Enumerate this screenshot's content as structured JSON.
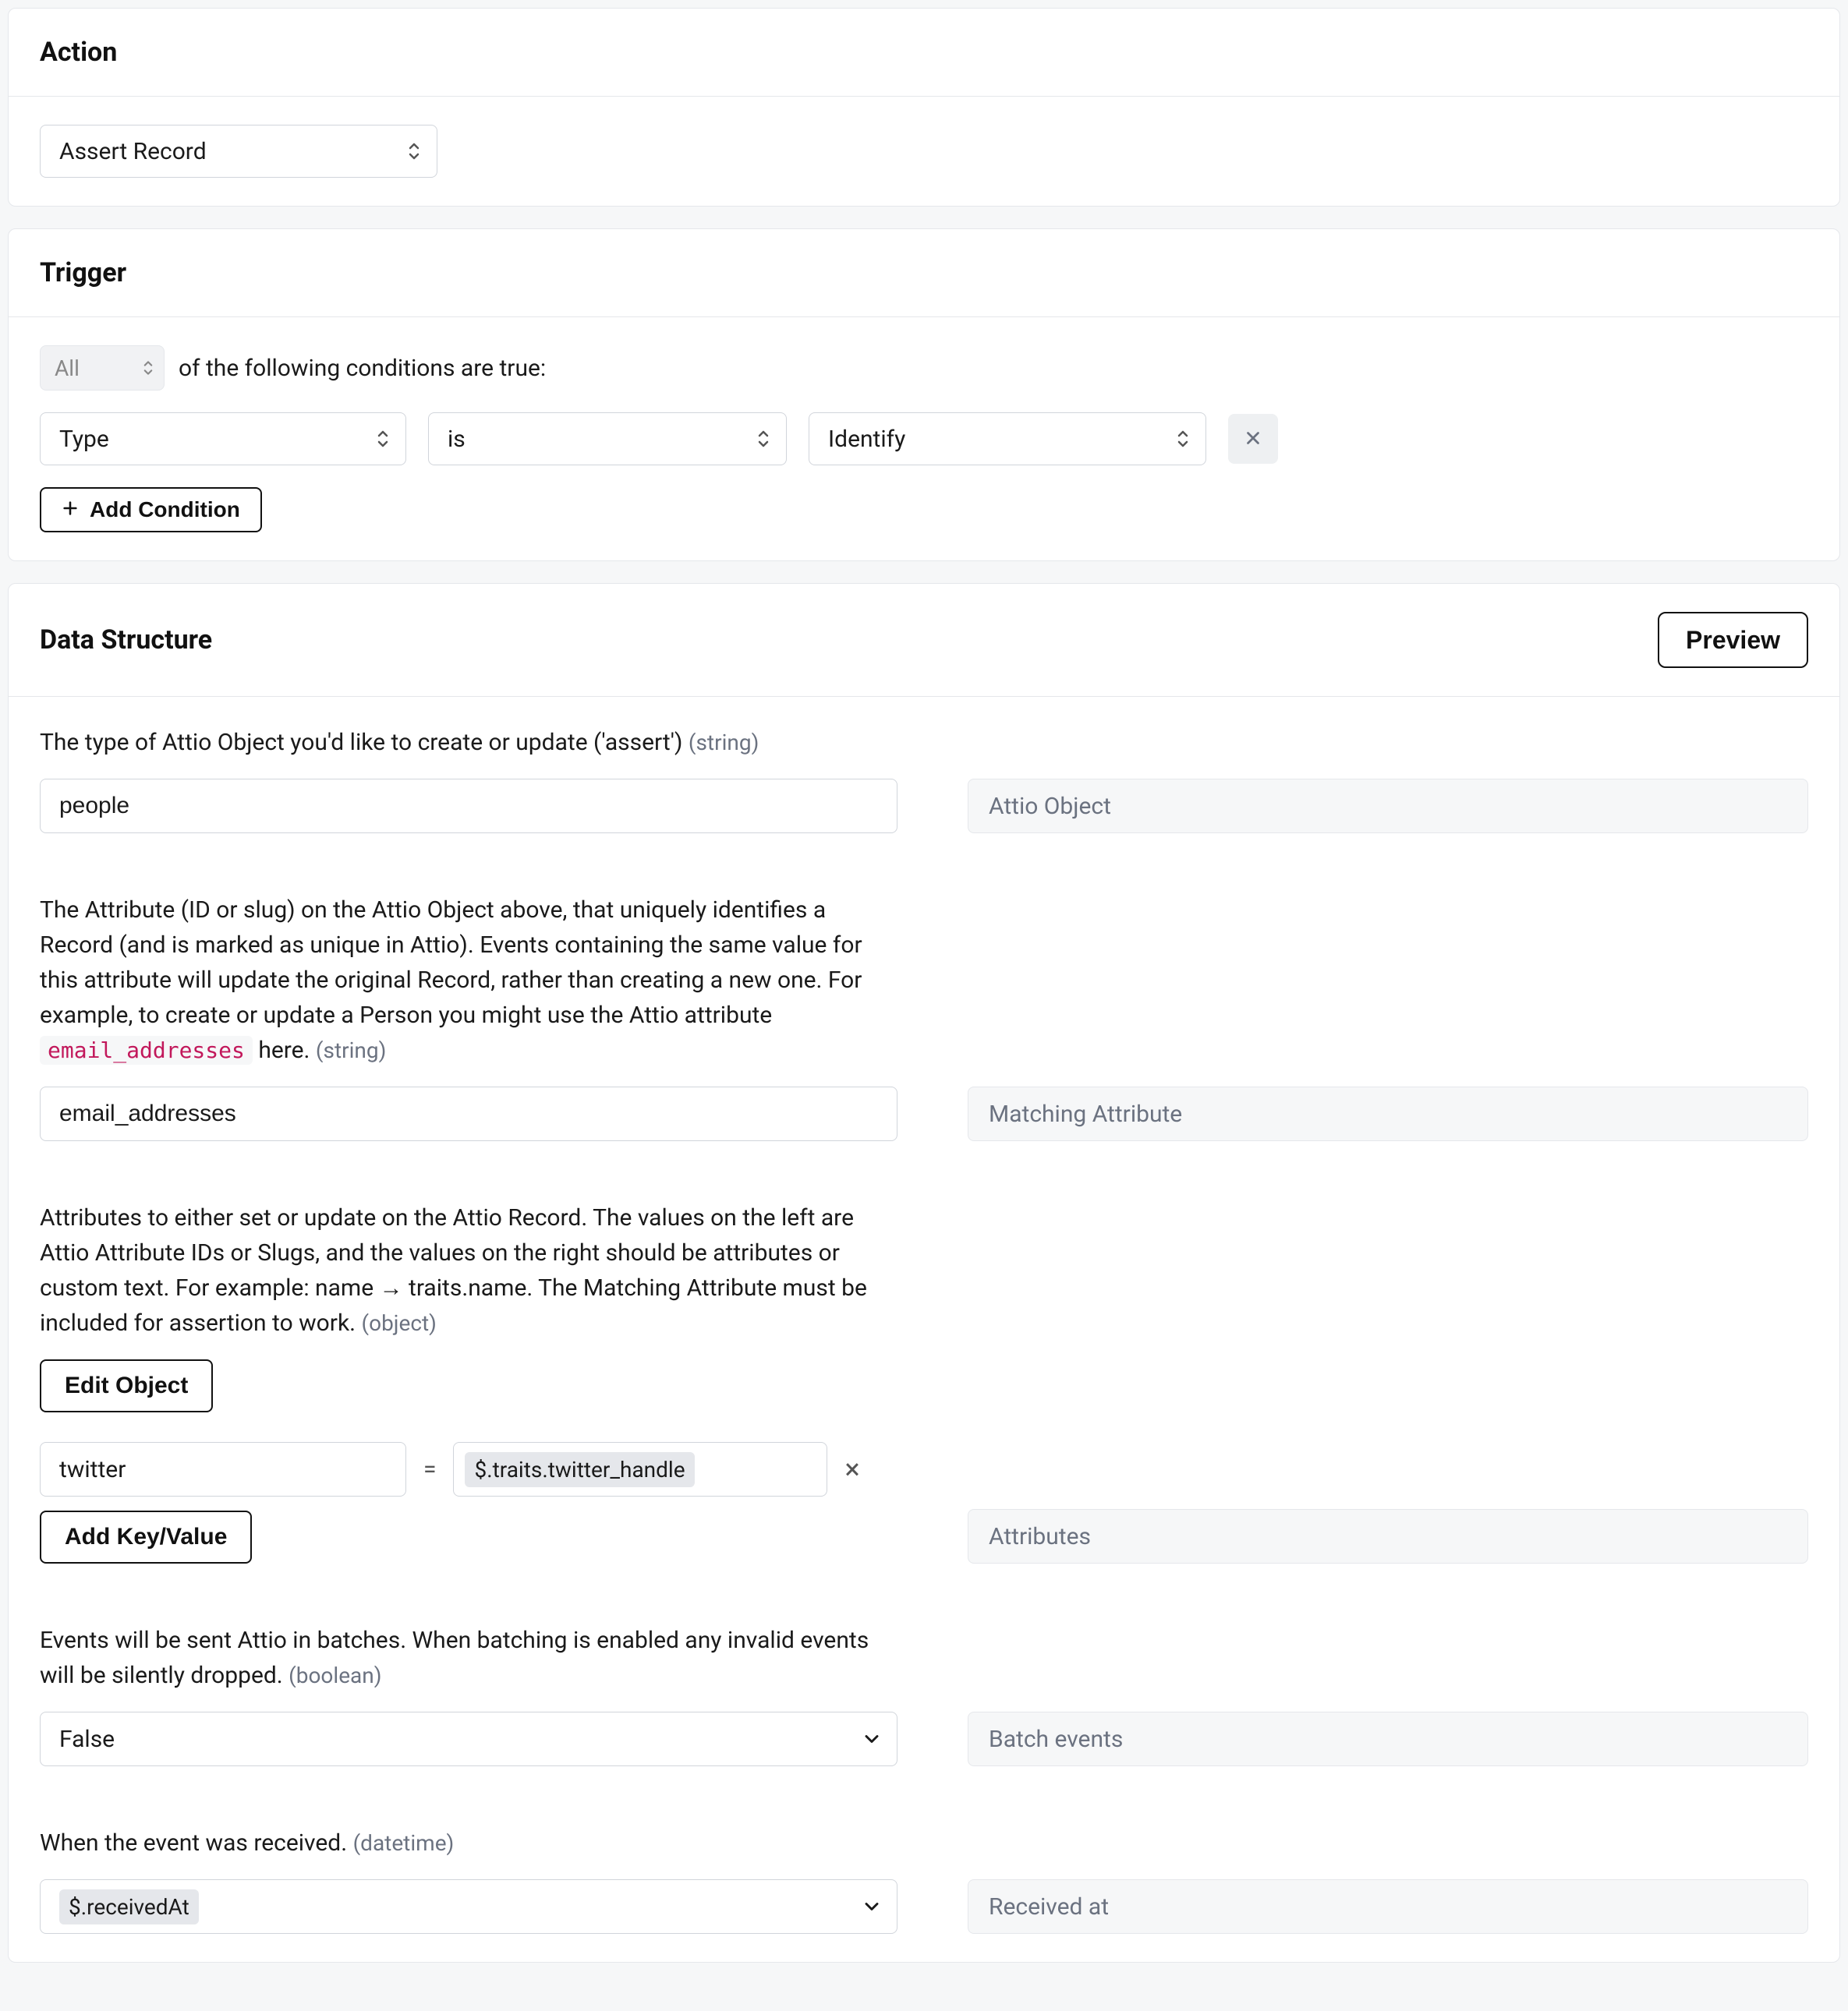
{
  "action": {
    "title": "Action",
    "select_value": "Assert Record"
  },
  "trigger": {
    "title": "Trigger",
    "mode_value": "All",
    "mode_suffix": "of the following conditions are true:",
    "condition": {
      "field": "Type",
      "operator": "is",
      "value": "Identify"
    },
    "add_condition_label": "Add Condition"
  },
  "data_structure": {
    "title": "Data Structure",
    "preview_label": "Preview",
    "fields": {
      "object_type": {
        "desc": "The type of Attio Object you'd like to create or update ('assert')",
        "type_hint": "(string)",
        "value": "people",
        "side_label": "Attio Object"
      },
      "matching_attr": {
        "desc_prefix": "The Attribute (ID or slug) on the Attio Object above, that uniquely identifies a Record (and is marked as unique in Attio). Events containing the same value for this attribute will update the original Record, rather than creating a new one. For example, to create or update a Person you might use the Attio attribute ",
        "code": "email_addresses",
        "desc_suffix": " here.",
        "type_hint": "(string)",
        "value": "email_addresses",
        "side_label": "Matching Attribute"
      },
      "attributes": {
        "desc": "Attributes to either set or update on the Attio Record. The values on the left are Attio Attribute IDs or Slugs, and the values on the right should be attributes or custom text. For example: name → traits.name. The Matching Attribute must be included for assertion to work.",
        "type_hint": "(object)",
        "edit_label": "Edit Object",
        "kv": {
          "key": "twitter",
          "value": "$.traits.twitter_handle"
        },
        "add_label": "Add Key/Value",
        "side_label": "Attributes"
      },
      "batch": {
        "desc": "Events will be sent Attio in batches. When batching is enabled any invalid events will be silently dropped.",
        "type_hint": "(boolean)",
        "value": "False",
        "side_label": "Batch events"
      },
      "received_at": {
        "desc": "When the event was received.",
        "type_hint": "(datetime)",
        "value": "$.receivedAt",
        "side_label": "Received at"
      }
    }
  }
}
